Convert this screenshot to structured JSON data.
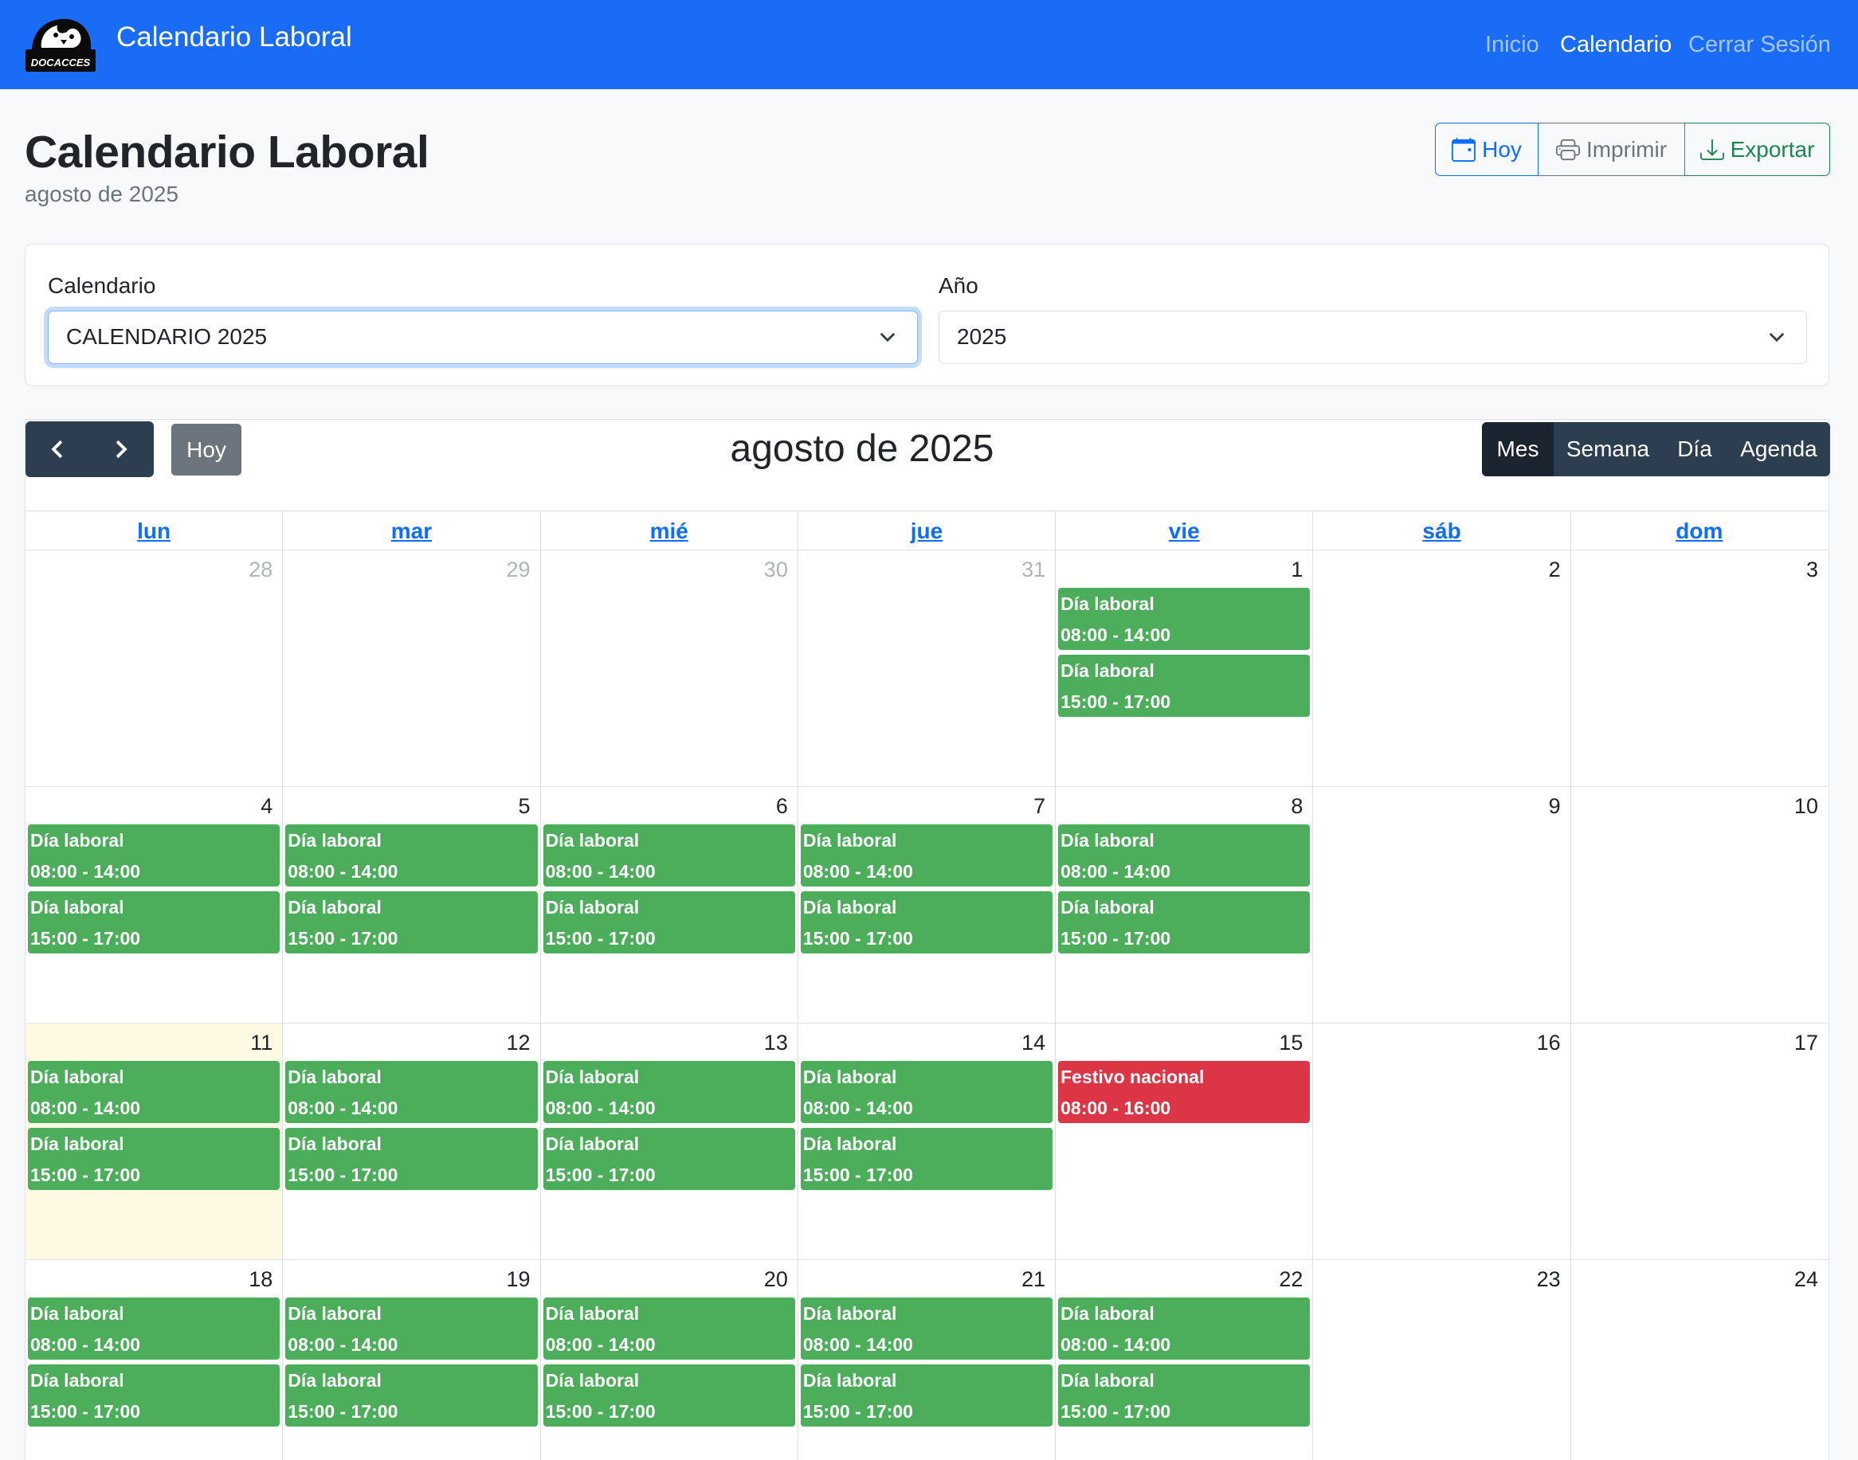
{
  "navbar": {
    "brand": "Calendario Laboral",
    "logo_text": "DOCACCES",
    "links": [
      {
        "label": "Inicio",
        "active": false
      },
      {
        "label": "Calendario",
        "active": true
      },
      {
        "label": "Cerrar Sesión",
        "active": false
      }
    ]
  },
  "header": {
    "title": "Calendario Laboral",
    "subtitle": "agosto de 2025",
    "buttons": {
      "today": "Hoy",
      "print": "Imprimir",
      "export": "Exportar"
    }
  },
  "filters": {
    "calendar_label": "Calendario",
    "calendar_value": "CALENDARIO 2025",
    "year_label": "Año",
    "year_value": "2025"
  },
  "calendar": {
    "title": "agosto de 2025",
    "today_label": "Hoy",
    "views": [
      "Mes",
      "Semana",
      "Día",
      "Agenda"
    ],
    "active_view": "Mes",
    "weekdays": [
      "lun",
      "mar",
      "mié",
      "jue",
      "vie",
      "sáb",
      "dom"
    ],
    "weeks": [
      [
        {
          "day": "28",
          "other": true,
          "events": []
        },
        {
          "day": "29",
          "other": true,
          "events": []
        },
        {
          "day": "30",
          "other": true,
          "events": []
        },
        {
          "day": "31",
          "other": true,
          "events": []
        },
        {
          "day": "1",
          "events": [
            {
              "title": "Día laboral",
              "time": "08:00 - 14:00"
            },
            {
              "title": "Día laboral",
              "time": "15:00 - 17:00"
            }
          ]
        },
        {
          "day": "2",
          "events": []
        },
        {
          "day": "3",
          "events": []
        }
      ],
      [
        {
          "day": "4",
          "events": [
            {
              "title": "Día laboral",
              "time": "08:00 - 14:00"
            },
            {
              "title": "Día laboral",
              "time": "15:00 - 17:00"
            }
          ]
        },
        {
          "day": "5",
          "events": [
            {
              "title": "Día laboral",
              "time": "08:00 - 14:00"
            },
            {
              "title": "Día laboral",
              "time": "15:00 - 17:00"
            }
          ]
        },
        {
          "day": "6",
          "events": [
            {
              "title": "Día laboral",
              "time": "08:00 - 14:00"
            },
            {
              "title": "Día laboral",
              "time": "15:00 - 17:00"
            }
          ]
        },
        {
          "day": "7",
          "events": [
            {
              "title": "Día laboral",
              "time": "08:00 - 14:00"
            },
            {
              "title": "Día laboral",
              "time": "15:00 - 17:00"
            }
          ]
        },
        {
          "day": "8",
          "events": [
            {
              "title": "Día laboral",
              "time": "08:00 - 14:00"
            },
            {
              "title": "Día laboral",
              "time": "15:00 - 17:00"
            }
          ]
        },
        {
          "day": "9",
          "events": []
        },
        {
          "day": "10",
          "events": []
        }
      ],
      [
        {
          "day": "11",
          "today": true,
          "events": [
            {
              "title": "Día laboral",
              "time": "08:00 - 14:00"
            },
            {
              "title": "Día laboral",
              "time": "15:00 - 17:00"
            }
          ]
        },
        {
          "day": "12",
          "events": [
            {
              "title": "Día laboral",
              "time": "08:00 - 14:00"
            },
            {
              "title": "Día laboral",
              "time": "15:00 - 17:00"
            }
          ]
        },
        {
          "day": "13",
          "events": [
            {
              "title": "Día laboral",
              "time": "08:00 - 14:00"
            },
            {
              "title": "Día laboral",
              "time": "15:00 - 17:00"
            }
          ]
        },
        {
          "day": "14",
          "events": [
            {
              "title": "Día laboral",
              "time": "08:00 - 14:00"
            },
            {
              "title": "Día laboral",
              "time": "15:00 - 17:00"
            }
          ]
        },
        {
          "day": "15",
          "events": [
            {
              "title": "Festivo nacional",
              "time": "08:00 - 16:00",
              "holiday": true
            }
          ]
        },
        {
          "day": "16",
          "events": []
        },
        {
          "day": "17",
          "events": []
        }
      ],
      [
        {
          "day": "18",
          "events": [
            {
              "title": "Día laboral",
              "time": "08:00 - 14:00"
            },
            {
              "title": "Día laboral",
              "time": "15:00 - 17:00"
            }
          ]
        },
        {
          "day": "19",
          "events": [
            {
              "title": "Día laboral",
              "time": "08:00 - 14:00"
            },
            {
              "title": "Día laboral",
              "time": "15:00 - 17:00"
            }
          ]
        },
        {
          "day": "20",
          "events": [
            {
              "title": "Día laboral",
              "time": "08:00 - 14:00"
            },
            {
              "title": "Día laboral",
              "time": "15:00 - 17:00"
            }
          ]
        },
        {
          "day": "21",
          "events": [
            {
              "title": "Día laboral",
              "time": "08:00 - 14:00"
            },
            {
              "title": "Día laboral",
              "time": "15:00 - 17:00"
            }
          ]
        },
        {
          "day": "22",
          "events": [
            {
              "title": "Día laboral",
              "time": "08:00 - 14:00"
            },
            {
              "title": "Día laboral",
              "time": "15:00 - 17:00"
            }
          ]
        },
        {
          "day": "23",
          "events": []
        },
        {
          "day": "24",
          "events": []
        }
      ]
    ]
  },
  "colors": {
    "navbar": "#1a6cf6",
    "event_workday": "#4cae5a",
    "event_holiday": "#dc3545",
    "today_bg": "#fdf9e3",
    "toolbar": "#2c3e50"
  }
}
